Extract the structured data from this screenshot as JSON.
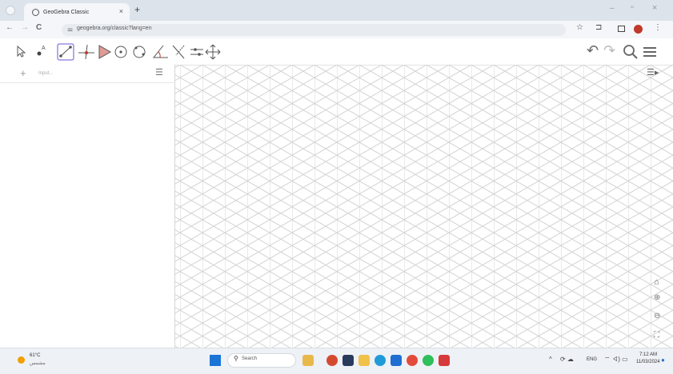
{
  "browser": {
    "tab_title": "GeoGebra Classic",
    "tab_close": "×",
    "new_tab": "+",
    "url": "geogebra.org/classic?lang=en",
    "window_controls": [
      "–",
      "▫",
      "×"
    ],
    "nav": {
      "back": "←",
      "forward": "→",
      "reload": "C"
    }
  },
  "toolbar_icons": [
    "move-tool",
    "point-tool",
    "line-tool",
    "perpendicular-tool",
    "polygon-tool",
    "circle-tool",
    "circle-3pt-tool",
    "angle-tool",
    "reflect-tool",
    "slider-tool",
    "move-graphics-tool"
  ],
  "algebra": {
    "input_placeholder": "Input..."
  },
  "taskbar": {
    "temperature": "61°C",
    "weather_sub": "مشمس",
    "search_label": "Search",
    "lang": "ENG",
    "time": "7:12 AM",
    "date": "11/03/2024"
  },
  "colors": {
    "accent": "#6557d2",
    "grid": "#cfcfcf",
    "tabbar": "#dde3ea"
  }
}
